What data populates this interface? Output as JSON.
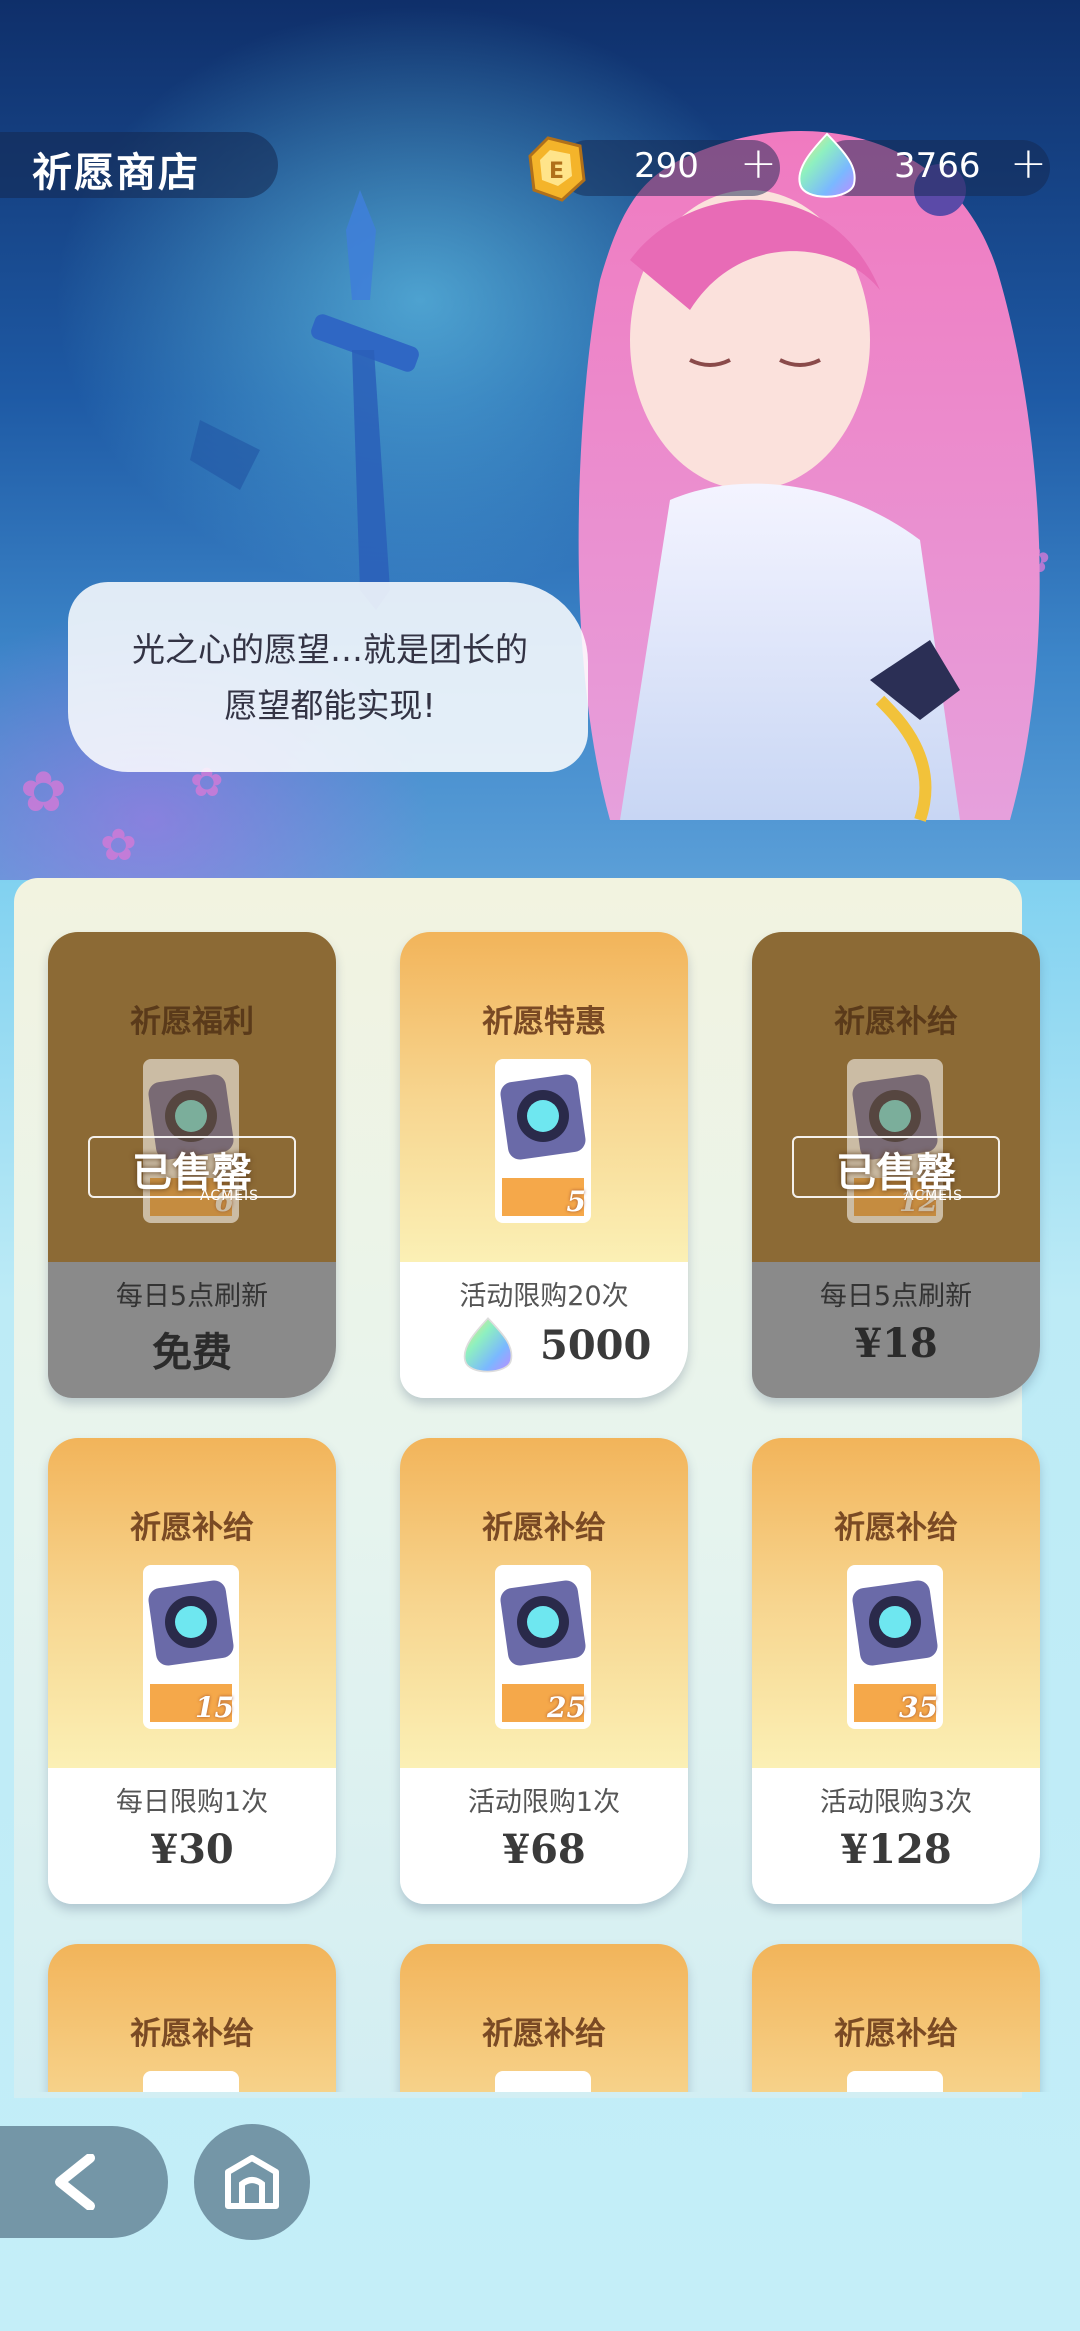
{
  "header": {
    "title": "祈愿商店",
    "currency_gold": {
      "icon": "gold-crystal-icon",
      "value": "290",
      "plus": "+"
    },
    "currency_gem": {
      "icon": "rainbow-gem-icon",
      "value": "3766",
      "plus": "+"
    }
  },
  "dialogue": {
    "line1": "光之心的愿望…就是团长的",
    "line2": "愿望都能实现!"
  },
  "cards": [
    {
      "name": "祈愿福利",
      "count": "6",
      "limit": "每日5点刷新",
      "price": "免费",
      "sold_out": true
    },
    {
      "name": "祈愿特惠",
      "count": "5",
      "limit": "活动限购20次",
      "price": "5000",
      "price_icon": "rainbow-gem-icon",
      "sold_out": false
    },
    {
      "name": "祈愿补给",
      "count": "12",
      "limit": "每日5点刷新",
      "price": "¥18",
      "sold_out": true
    },
    {
      "name": "祈愿补给",
      "count": "15",
      "limit": "每日限购1次",
      "price": "¥30",
      "sold_out": false
    },
    {
      "name": "祈愿补给",
      "count": "25",
      "limit": "活动限购1次",
      "price": "¥68",
      "sold_out": false
    },
    {
      "name": "祈愿补给",
      "count": "35",
      "limit": "活动限购3次",
      "price": "¥128",
      "sold_out": false
    },
    {
      "name": "祈愿补给"
    },
    {
      "name": "祈愿补给"
    },
    {
      "name": "祈愿补给"
    }
  ],
  "sold_out_label": "已售罄",
  "sold_out_watermark": "ACMEIS",
  "nav": {
    "back_icon": "back-arrow-icon",
    "home_icon": "home-icon"
  },
  "colors": {
    "card_gold": "#f2b45a",
    "card_sold": "#8c6a35",
    "panel_bg": "#f2f3e0"
  }
}
